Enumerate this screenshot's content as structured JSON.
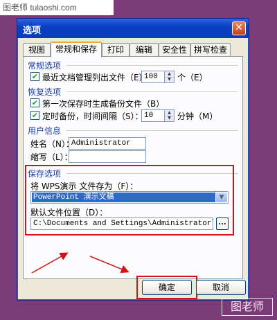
{
  "watermark_top": "图老师 tulaoshi.com",
  "watermark_bottom": "图老师",
  "dialog": {
    "title": "选项",
    "close_glyph": "✕",
    "tabs": [
      {
        "label": "视图"
      },
      {
        "label": "常规和保存"
      },
      {
        "label": "打印"
      },
      {
        "label": "编辑"
      },
      {
        "label": "安全性"
      },
      {
        "label": "拼写检查"
      }
    ],
    "general": {
      "group_label": "常规选项",
      "recent_files_label": "最近文档管理列出文件（E）：",
      "recent_files_value": "100",
      "recent_files_unit": "个（E）"
    },
    "recovery": {
      "group_label": "恢复选项",
      "first_save_backup_label": "第一次保存时生成备份文件（B）",
      "timed_backup_label": "定时备份，时间间隔（S）：",
      "timed_backup_value": "10",
      "timed_backup_unit": "分钟（M）"
    },
    "user_info": {
      "group_label": "用户信息",
      "name_label": "姓名（N）：",
      "name_value": "Administrator",
      "initials_label": "缩写（L）：",
      "initials_value": ""
    },
    "save_options": {
      "group_label": "保存选项",
      "save_as_label": "将 WPS演示 文件存为（F）：",
      "save_as_value": "PowerPoint 演示文稿",
      "default_location_label": "默认文件位置（D）：",
      "default_location_value": "C:\\Documents and Settings\\Administrator\\My Doc",
      "browse_label": "..."
    },
    "ok_label": "确定",
    "cancel_label": "取消",
    "checkbox_mark": "✔",
    "spin_up": "▲",
    "spin_down": "▼",
    "select_arrow": "▼"
  },
  "colors": {
    "background": "#7a3b78",
    "highlight_box": "#d4121a",
    "selection": "#316ac5"
  }
}
